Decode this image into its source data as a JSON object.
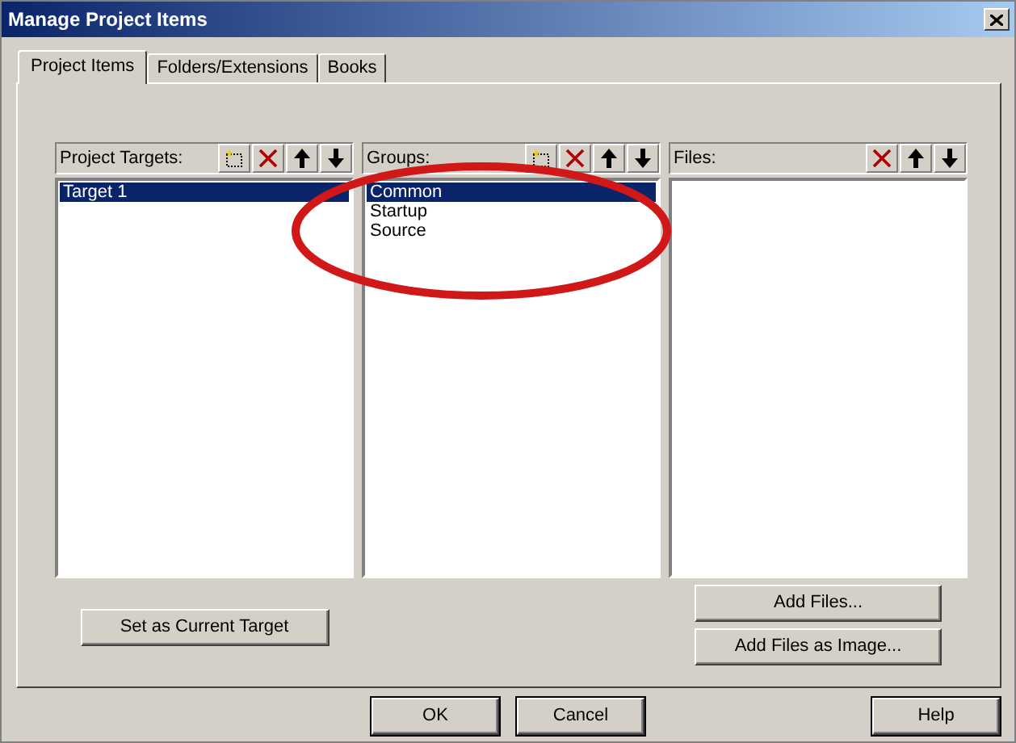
{
  "window": {
    "title": "Manage Project Items"
  },
  "tabs": [
    {
      "label": "Project Items",
      "selected": true
    },
    {
      "label": "Folders/Extensions",
      "selected": false
    },
    {
      "label": "Books",
      "selected": false
    }
  ],
  "panels": [
    {
      "title": "Project Targets:",
      "tools": [
        {
          "kind": "new"
        },
        {
          "kind": "delete"
        },
        {
          "kind": "up"
        },
        {
          "kind": "down"
        }
      ],
      "items": [
        {
          "label": "Target 1",
          "selected": true
        }
      ]
    },
    {
      "title": "Groups:",
      "tools": [
        {
          "kind": "new"
        },
        {
          "kind": "delete"
        },
        {
          "kind": "up"
        },
        {
          "kind": "down"
        }
      ],
      "items": [
        {
          "label": "Common",
          "selected": true
        },
        {
          "label": "Startup",
          "selected": false
        },
        {
          "label": "Source",
          "selected": false
        }
      ]
    },
    {
      "title": "Files:",
      "tools": [
        {
          "kind": "delete"
        },
        {
          "kind": "up"
        },
        {
          "kind": "down"
        }
      ]
    }
  ],
  "target_buttons": [
    {
      "label": "Set as Current Target"
    }
  ],
  "file_buttons": [
    {
      "label": "Add Files..."
    },
    {
      "label": "Add Files as Image..."
    }
  ],
  "footer_buttons": [
    {
      "label": "OK",
      "kind": "left"
    },
    {
      "label": "Cancel",
      "kind": "left"
    },
    {
      "label": "Help",
      "kind": "right"
    }
  ]
}
